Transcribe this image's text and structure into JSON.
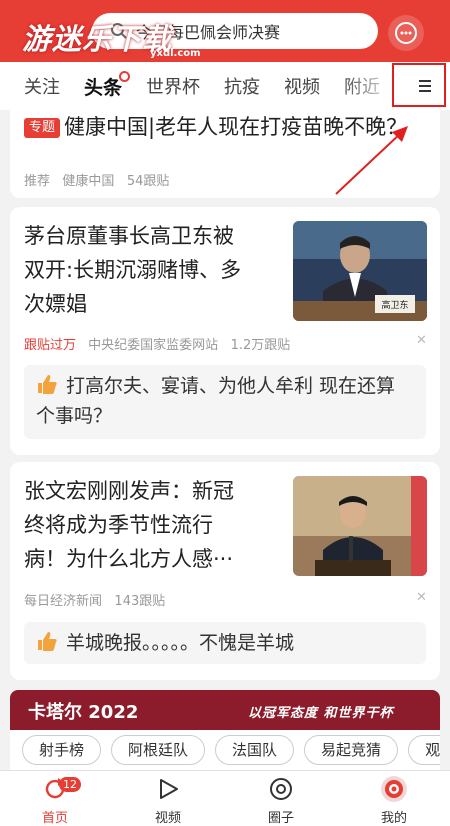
{
  "watermark": {
    "text": "游迷乐下载",
    "url": "yxdl.com"
  },
  "search": {
    "query": "今日每巴佩会师决赛"
  },
  "tabs": [
    {
      "label": "关注"
    },
    {
      "label": "头条"
    },
    {
      "label": "世界杯"
    },
    {
      "label": "抗疫"
    },
    {
      "label": "视频"
    },
    {
      "label": "附近"
    }
  ],
  "feed": [
    {
      "tag": "专题",
      "title": "健康中国|老年人现在打疫苗晚不晚？",
      "meta": [
        "推荐",
        "健康中国",
        "54跟贴"
      ]
    },
    {
      "title_lines": [
        "茅台原董事长高卫东被",
        "双开:长期沉溺赌博、多",
        "次嫖娼"
      ],
      "image_caption": "高卫东",
      "hot": "跟贴过万",
      "source": "中央纪委国家监委网站",
      "comments": "1.2万跟贴",
      "sub": "打高尔夫、宴请、为他人牟利 现在还算个事吗？"
    },
    {
      "title_lines": [
        "张文宏刚刚发声：新冠",
        "终将成为季节性流行",
        "病！为什么北方人感···"
      ],
      "source": "每日经济新闻",
      "comments": "143跟贴",
      "sub": "羊城晚报。。。。。不愧是羊城"
    }
  ],
  "banner": {
    "title": "卡塔尔 2022",
    "slogan": "以冠军态度 和世界干杯"
  },
  "chips": [
    "射手榜",
    "阿根廷队",
    "法国队",
    "易起竞猜",
    "观战"
  ],
  "bottom_nav": [
    {
      "label": "首页",
      "badge": "12"
    },
    {
      "label": "视频"
    },
    {
      "label": "圈子"
    },
    {
      "label": "我的"
    }
  ],
  "colors": {
    "brand": "#e63d35",
    "annotation": "#e02020"
  },
  "icons": [
    "search-icon",
    "chat-icon",
    "menu-icon",
    "home-refresh-icon",
    "play-icon",
    "circle-icon",
    "avatar-icon",
    "thumbs-up-icon",
    "close-icon"
  ]
}
